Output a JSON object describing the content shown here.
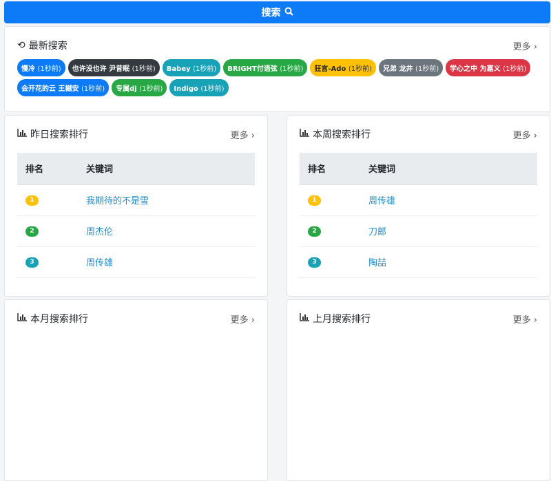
{
  "search_label": "搜索",
  "recent": {
    "title": "最新搜索",
    "more": "更多",
    "tags": [
      {
        "name": "慢冷",
        "time": "(1秒前)",
        "color": "#0d7bf7"
      },
      {
        "name": "也许没也许 尹昔眠",
        "time": "(1秒前)",
        "color": "#343a40"
      },
      {
        "name": "Babey",
        "time": "(1秒前)",
        "color": "#17a2b8"
      },
      {
        "name": "BRIGHT付语弦",
        "time": "(1秒前)",
        "color": "#28a745"
      },
      {
        "name": "狂言-Ado",
        "time": "(1秒前)",
        "color": "#ffc107",
        "dark": true
      },
      {
        "name": "兄弟 龙井",
        "time": "(1秒前)",
        "color": "#6c757d"
      },
      {
        "name": "学心之中 为嘉义",
        "time": "(1秒前)",
        "color": "#dc3545"
      },
      {
        "name": "会开花的云 王樾安",
        "time": "(1秒前)",
        "color": "#0d7bf7"
      },
      {
        "name": "专属dj",
        "time": "(1秒前)",
        "color": "#28a745"
      },
      {
        "name": "Indigo",
        "time": "(1秒前)",
        "color": "#17a2b8"
      }
    ]
  },
  "rank_cols": [
    "排名",
    "关键词"
  ],
  "rank_colors": [
    "#ffc107",
    "#28a745",
    "#17a2b8"
  ],
  "boards": [
    {
      "title": "昨日搜索排行",
      "more": "更多",
      "rows": [
        {
          "rank": "1",
          "kw": "我期待的不是雪"
        },
        {
          "rank": "2",
          "kw": "周杰伦"
        },
        {
          "rank": "3",
          "kw": "周传雄"
        }
      ]
    },
    {
      "title": "本周搜索排行",
      "more": "更多",
      "rows": [
        {
          "rank": "1",
          "kw": "周传雄"
        },
        {
          "rank": "2",
          "kw": "刀郎"
        },
        {
          "rank": "3",
          "kw": "陶喆"
        }
      ]
    },
    {
      "title": "本月搜索排行",
      "more": "更多",
      "rows": []
    },
    {
      "title": "上月搜索排行",
      "more": "更多",
      "rows": []
    }
  ]
}
